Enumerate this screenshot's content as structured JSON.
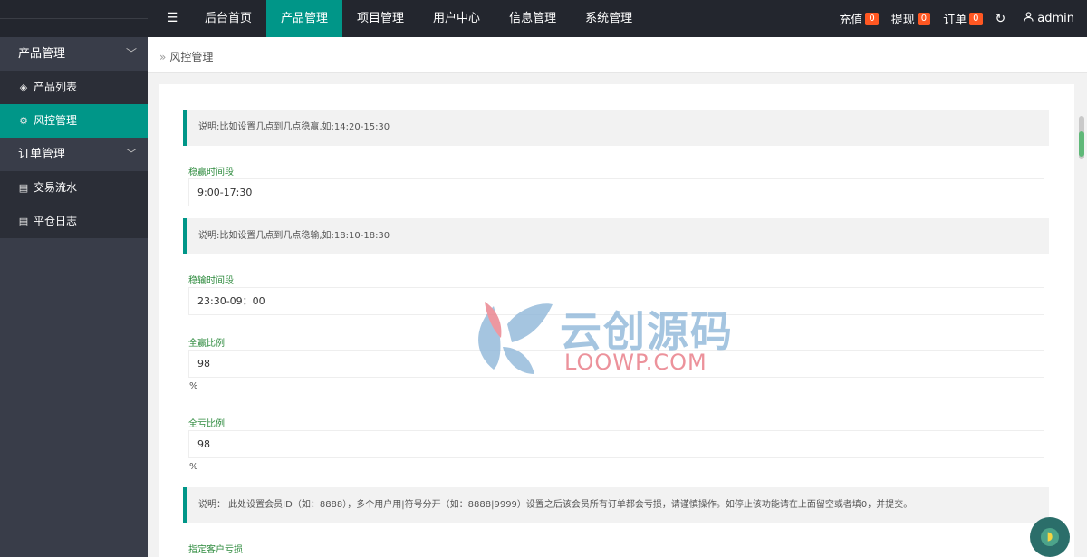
{
  "topbar": {
    "menu_toggle_icon": "menu-toggle-icon",
    "nav": [
      "后台首页",
      "产品管理",
      "项目管理",
      "用户中心",
      "信息管理",
      "系统管理"
    ],
    "active_nav_index": 1,
    "recharge_label": "充值",
    "recharge_count": "0",
    "withdraw_label": "提现",
    "withdraw_count": "0",
    "order_label": "订单",
    "order_count": "0",
    "user_name": "admin"
  },
  "sidebar": {
    "group1": "产品管理",
    "item_product_list": "产品列表",
    "item_risk_control": "风控管理",
    "group2": "订单管理",
    "item_trade_flow": "交易流水",
    "item_close_log": "平仓日志"
  },
  "breadcrumb": {
    "current": "风控管理"
  },
  "form": {
    "tip1": "说明:比如设置几点到几点稳赢,如:14:20-15:30",
    "win_period_label": "稳赢时间段",
    "win_period_value": "9:00-17:30",
    "tip2": "说明:比如设置几点到几点稳输,如:18:10-18:30",
    "lose_period_label": "稳输时间段",
    "lose_period_value": "23:30-09：00",
    "win_ratio_label": "全赢比例",
    "win_ratio_value": "98",
    "win_ratio_unit": "%",
    "lose_ratio_label": "全亏比例",
    "lose_ratio_value": "98",
    "lose_ratio_unit": "%",
    "tip3": "说明： 此处设置会员ID（如：8888），多个用户用|符号分开（如：8888|9999）设置之后该会员所有订单都会亏损，请谨慎操作。如停止该功能请在上面留空或者填0，并提交。",
    "specified_loss_label": "指定客户亏损"
  },
  "watermark": {
    "cn": "云创源码",
    "en": "LOOWP.COM"
  },
  "colors": {
    "accent": "#009688",
    "topbar": "#23262e",
    "sidebar": "#393d49",
    "badge": "#ff5722",
    "label": "#2e8b3e"
  }
}
